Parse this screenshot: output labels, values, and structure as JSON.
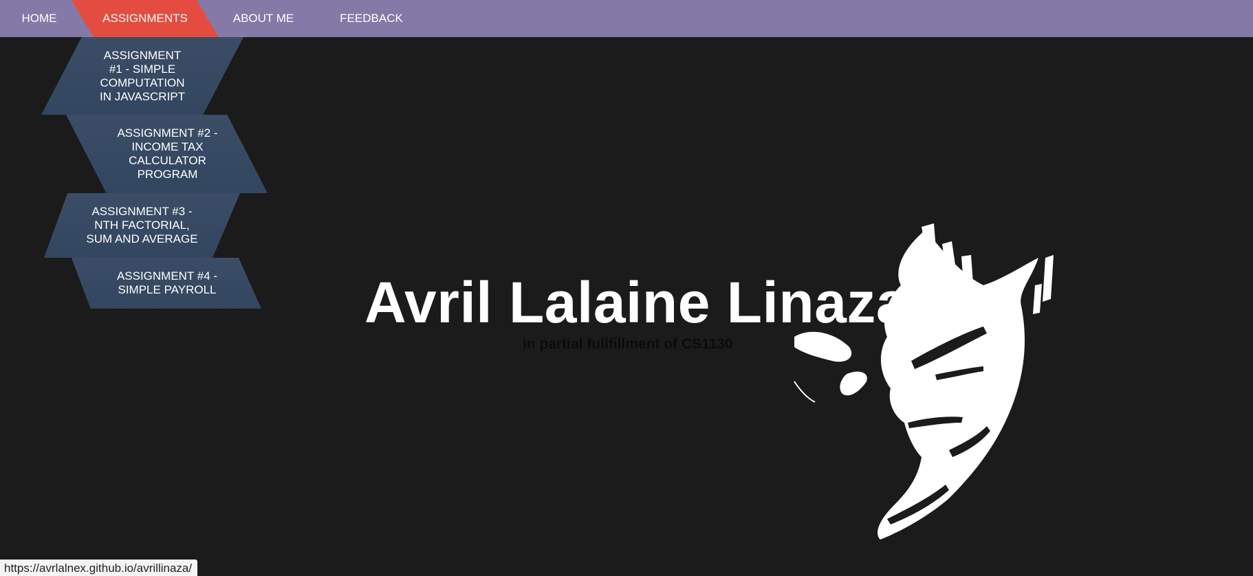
{
  "nav": {
    "items": [
      {
        "label": "HOME"
      },
      {
        "label": "ASSIGNMENTS"
      },
      {
        "label": "ABOUT ME"
      },
      {
        "label": "FEEDBACK"
      }
    ],
    "active": "ASSIGNMENTS"
  },
  "dropdown": {
    "items": [
      {
        "label": "ASSIGNMENT #1 - SIMPLE COMPUTATION IN JAVASCRIPT"
      },
      {
        "label": "ASSIGNMENT #2 - INCOME TAX CALCULATOR PROGRAM"
      },
      {
        "label": "ASSIGNMENT #3 - NTH FACTORIAL, SUM AND AVERAGE"
      },
      {
        "label": "ASSIGNMENT #4 - SIMPLE PAYROLL"
      }
    ]
  },
  "hero": {
    "title": "Avril Lalaine Linaza",
    "subtitle": "in partial fullfillment of CS1130"
  },
  "status_bar": {
    "url": "https://avrlalnex.github.io/avrillinaza/"
  },
  "colors": {
    "nav_bg": "#8579a8",
    "nav_active": "#e44c40",
    "dropdown_bg": "#3b4d66",
    "page_bg": "#1b1b1b"
  },
  "icons": {
    "hero_art": "anime-character-silhouette"
  }
}
